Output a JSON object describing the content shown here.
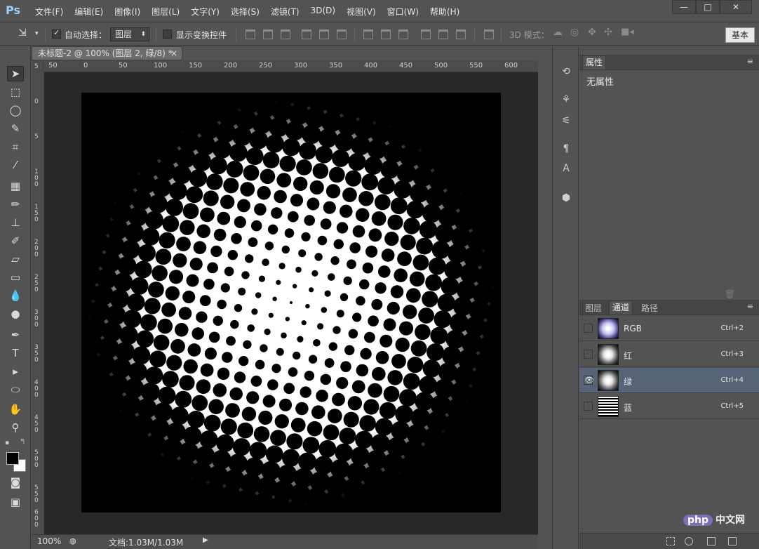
{
  "app": {
    "logo": "Ps"
  },
  "menus": [
    "文件(F)",
    "编辑(E)",
    "图像(I)",
    "图层(L)",
    "文字(Y)",
    "选择(S)",
    "滤镜(T)",
    "3D(D)",
    "视图(V)",
    "窗口(W)",
    "帮助(H)"
  ],
  "window_buttons": {
    "minimize": "—",
    "maximize": "□",
    "close": "✕"
  },
  "options": {
    "auto_select_label": "自动选择：",
    "auto_select_checked": true,
    "layer_select_value": "图层",
    "show_transform_label": "显示变换控件",
    "show_transform_checked": false,
    "mode_3d_label": "3D 模式：",
    "workspace_button": "基本"
  },
  "document": {
    "tab_title": "未标题-2 @ 100% (图层 2, 绿/8) *",
    "tab_close": "×",
    "ruler_top_ticks": [
      "50",
      "0",
      "50",
      "100",
      "150",
      "200",
      "250",
      "300",
      "350",
      "400",
      "450",
      "500",
      "550",
      "600"
    ],
    "ruler_left_ticks": [
      "5",
      "0",
      "5",
      "1\n0\n0",
      "1\n5\n0",
      "2\n0\n0",
      "2\n5\n0",
      "3\n0\n0",
      "3\n5\n0",
      "4\n0\n0",
      "4\n5\n0",
      "5\n0\n0",
      "5\n5\n0",
      "6\n0\n0"
    ]
  },
  "status": {
    "zoom": "100%",
    "doc_info": "文档:1.03M/1.03M",
    "arrow": "▶"
  },
  "properties_panel": {
    "tab": "属性",
    "body_text": "无属性"
  },
  "channels_panel": {
    "tabs": [
      "图层",
      "通道",
      "路径"
    ],
    "active_tab": "通道",
    "channels": [
      {
        "name": "RGB",
        "shortcut": "Ctrl+2",
        "visible": false,
        "selected": false
      },
      {
        "name": "红",
        "shortcut": "Ctrl+3",
        "visible": false,
        "selected": false
      },
      {
        "name": "绿",
        "shortcut": "Ctrl+4",
        "visible": true,
        "selected": true
      },
      {
        "name": "蓝",
        "shortcut": "Ctrl+5",
        "visible": false,
        "selected": false
      }
    ]
  },
  "watermark": {
    "php": "php",
    "cn": "中文网"
  },
  "colors": {
    "foreground": "#000000",
    "background": "#ffffff",
    "selected_row": "#576477"
  }
}
